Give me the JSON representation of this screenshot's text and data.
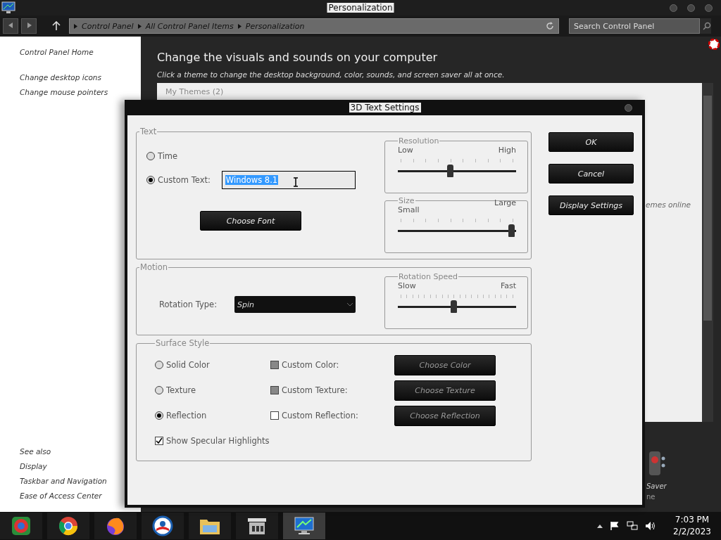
{
  "window": {
    "title": "Personalization"
  },
  "address": {
    "breadcrumbs": [
      "Control Panel",
      "All Control Panel Items",
      "Personalization"
    ],
    "search_placeholder": "Search Control Panel"
  },
  "sidebar": {
    "home": "Control Panel Home",
    "tasks": [
      "Change desktop icons",
      "Change mouse pointers"
    ],
    "see_also": "See also",
    "links": [
      "Display",
      "Taskbar and Navigation",
      "Ease of Access Center"
    ]
  },
  "main": {
    "heading": "Change the visuals and sounds on your computer",
    "subtitle": "Click a theme to change the desktop background, color, sounds, and screen saver all at once.",
    "themes_group": "My Themes (2)",
    "online_link": "emes online",
    "saver_label": "Saver",
    "saver_sub": "ne"
  },
  "dialog": {
    "title": "3D Text Settings",
    "text_group": {
      "legend": "Text",
      "options": [
        {
          "label": "Time",
          "selected": false
        },
        {
          "label": "Custom Text:",
          "selected": true
        }
      ],
      "custom_text": "Windows 8.1",
      "font_button": "Choose Font"
    },
    "resolution": {
      "legend": "Resolution",
      "min": "Low",
      "max": "High",
      "level": 0.44
    },
    "size": {
      "legend": "Size",
      "min": "Small",
      "max": "Large",
      "level": 0.96
    },
    "motion": {
      "legend": "Motion",
      "rotation_label": "Rotation Type:",
      "rotation_value": "Spin"
    },
    "speed": {
      "legend": "Rotation Speed",
      "min": "Slow",
      "max": "Fast",
      "level": 0.47
    },
    "surface": {
      "legend": "Surface Style",
      "rows": [
        {
          "option": "Solid Color",
          "selected": false,
          "custom": "Custom Color:",
          "filled": true,
          "button": "Choose Color"
        },
        {
          "option": "Texture",
          "selected": false,
          "custom": "Custom Texture:",
          "filled": true,
          "button": "Choose Texture"
        },
        {
          "option": "Reflection",
          "selected": true,
          "custom": "Custom Reflection:",
          "filled": false,
          "button": "Choose Reflection"
        }
      ],
      "specular": {
        "label": "Show Specular Highlights",
        "checked": true
      }
    },
    "buttons": [
      "OK",
      "Cancel",
      "Display Settings"
    ]
  },
  "taskbar": {
    "apps": [
      {
        "kind": "ball",
        "selected": false
      },
      {
        "kind": "browser",
        "selected": false
      },
      {
        "kind": "fox",
        "selected": false
      },
      {
        "kind": "globe",
        "selected": false
      },
      {
        "kind": "folder",
        "selected": false
      },
      {
        "kind": "store",
        "selected": false
      },
      {
        "kind": "monitor",
        "selected": true
      }
    ],
    "time": "7:03 PM",
    "date": "2/2/2023"
  }
}
